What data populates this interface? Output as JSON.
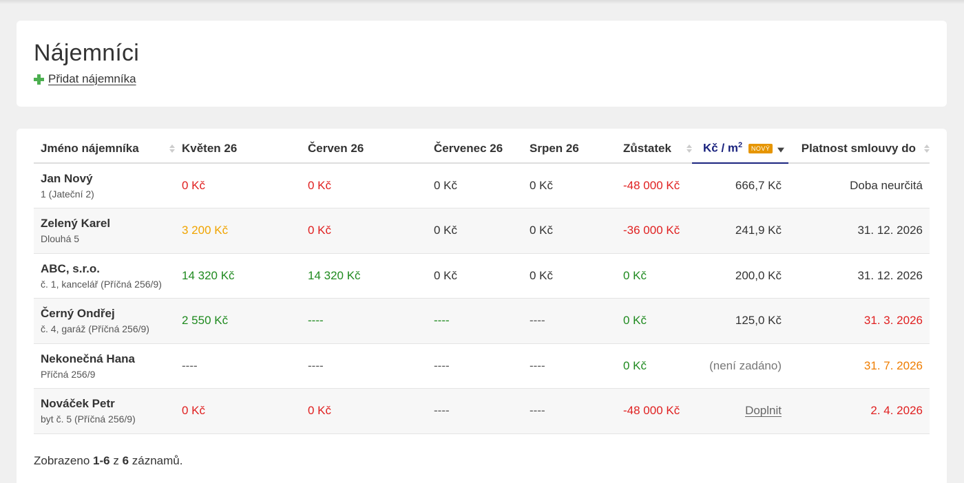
{
  "page": {
    "title": "Nájemníci",
    "add_label": "Přidat nájemníka"
  },
  "table": {
    "headers": {
      "name": "Jméno nájemníka",
      "m1": "Květen 26",
      "m2": "Červen 26",
      "m3": "Červenec 26",
      "m4": "Srpen 26",
      "balance": "Zůstatek",
      "price_prefix": "Kč / m",
      "price_sup": "2",
      "price_badge": "NOVÝ",
      "contract": "Platnost smlouvy do"
    },
    "rows": [
      {
        "name": "Jan Nový",
        "sub": "1 (Jateční 2)",
        "m1": "0 Kč",
        "m2": "0 Kč",
        "m3": "0 Kč",
        "m4": "0 Kč",
        "balance": "-48 000 Kč",
        "price": "666,7 Kč",
        "contract": "Doba neurčitá"
      },
      {
        "name": "Zelený Karel",
        "sub": "Dlouhá 5",
        "m1": "3 200 Kč",
        "m2": "0 Kč",
        "m3": "0 Kč",
        "m4": "0 Kč",
        "balance": "-36 000 Kč",
        "price": "241,9 Kč",
        "contract": "31. 12. 2026"
      },
      {
        "name": "ABC, s.r.o.",
        "sub": "č. 1, kancelář (Příčná 256/9)",
        "m1": "14 320 Kč",
        "m2": "14 320 Kč",
        "m3": "0 Kč",
        "m4": "0 Kč",
        "balance": "0 Kč",
        "price": "200,0 Kč",
        "contract": "31. 12. 2026"
      },
      {
        "name": "Černý Ondřej",
        "sub": "č. 4, garáž (Příčná 256/9)",
        "m1": "2 550 Kč",
        "m2": "----",
        "m3": "----",
        "m4": "----",
        "balance": "0 Kč",
        "price": "125,0 Kč",
        "contract": "31. 3. 2026"
      },
      {
        "name": "Nekonečná Hana",
        "sub": "Příčná 256/9",
        "m1": "----",
        "m2": "----",
        "m3": "----",
        "m4": "----",
        "balance": "0 Kč",
        "price": "(není zadáno)",
        "contract": "31. 7. 2026"
      },
      {
        "name": "Nováček Petr",
        "sub": "byt č. 5 (Příčná 256/9)",
        "m1": "0 Kč",
        "m2": "0 Kč",
        "m3": "----",
        "m4": "----",
        "balance": "-48 000 Kč",
        "price": "Doplnit",
        "contract": "2. 4. 2026"
      }
    ]
  },
  "footer": {
    "prefix": "Zobrazeno",
    "range": "1-6",
    "middle": "z",
    "total": "6",
    "suffix": "záznamů."
  },
  "colors": {
    "negative": "#e02020",
    "positive": "#1f8a1f",
    "partial": "#f0a400",
    "expiring": "#ef7d00",
    "accent": "#1a237e",
    "badge": "#e69500"
  }
}
